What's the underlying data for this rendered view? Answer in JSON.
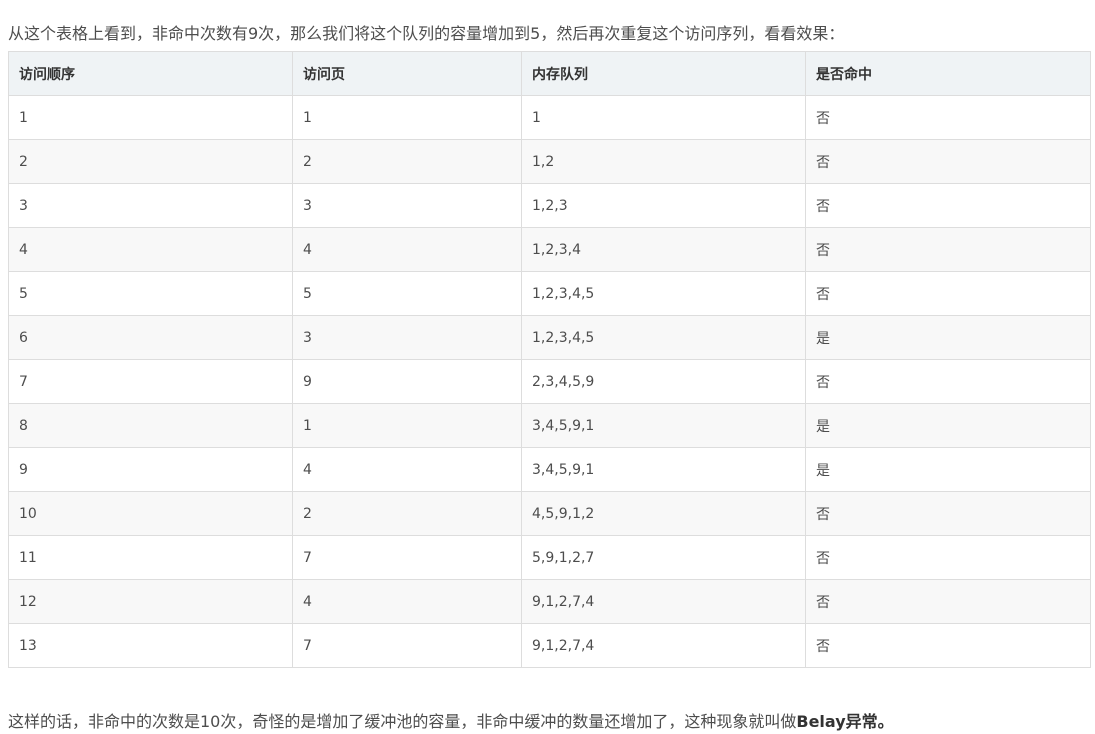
{
  "intro_text": "从这个表格上看到，非命中次数有9次，那么我们将这个队列的容量增加到5，然后再次重复这个访问序列，看看效果：",
  "table": {
    "headers": [
      "访问顺序",
      "访问页",
      "内存队列",
      "是否命中"
    ],
    "rows": [
      [
        "1",
        "1",
        "1",
        "否"
      ],
      [
        "2",
        "2",
        "1,2",
        "否"
      ],
      [
        "3",
        "3",
        "1,2,3",
        "否"
      ],
      [
        "4",
        "4",
        "1,2,3,4",
        "否"
      ],
      [
        "5",
        "5",
        "1,2,3,4,5",
        "否"
      ],
      [
        "6",
        "3",
        "1,2,3,4,5",
        "是"
      ],
      [
        "7",
        "9",
        "2,3,4,5,9",
        "否"
      ],
      [
        "8",
        "1",
        "3,4,5,9,1",
        "是"
      ],
      [
        "9",
        "4",
        "3,4,5,9,1",
        "是"
      ],
      [
        "10",
        "2",
        "4,5,9,1,2",
        "否"
      ],
      [
        "11",
        "7",
        "5,9,1,2,7",
        "否"
      ],
      [
        "12",
        "4",
        "9,1,2,7,4",
        "否"
      ],
      [
        "13",
        "7",
        "9,1,2,7,4",
        "否"
      ]
    ]
  },
  "outro": {
    "text": "这样的话，非命中的次数是10次，奇怪的是增加了缓冲池的容量，非命中缓冲的数量还增加了，这种现象就叫做",
    "bold": "Belay异常。"
  },
  "colors": {
    "header_bg": "#eff3f5",
    "stripe_bg": "#f8f8f8",
    "border": "#dddddd",
    "text": "#4d4d4d"
  }
}
